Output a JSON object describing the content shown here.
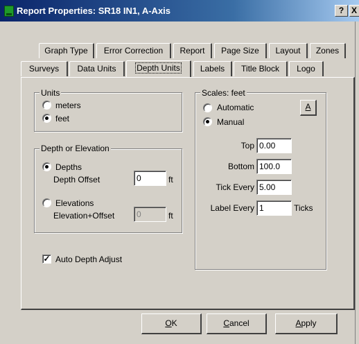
{
  "window": {
    "title": "Report Properties: SR18 IN1, A-Axis",
    "help_label": "?",
    "close_label": "X"
  },
  "tabs_row1": [
    {
      "label": "Graph Type"
    },
    {
      "label": "Error Correction"
    },
    {
      "label": "Report"
    },
    {
      "label": "Page Size"
    },
    {
      "label": "Layout"
    },
    {
      "label": "Zones"
    }
  ],
  "tabs_row2": [
    {
      "label": "Surveys"
    },
    {
      "label": "Data Units"
    },
    {
      "label": "Depth Units"
    },
    {
      "label": "Labels"
    },
    {
      "label": "Title Block"
    },
    {
      "label": "Logo"
    }
  ],
  "units": {
    "title": "Units",
    "meters": "meters",
    "feet": "feet",
    "selected": "feet"
  },
  "depth_or_elevation": {
    "title": "Depth or Elevation",
    "depths_label": "Depths",
    "depth_offset_label": "Depth Offset",
    "depth_offset_value": "0",
    "depth_offset_unit": "ft",
    "elevations_label": "Elevations",
    "elevation_offset_label": "Elevation+Offset",
    "elevation_offset_value": "0",
    "elevation_offset_unit": "ft",
    "selected": "Depths"
  },
  "auto_depth_adjust": {
    "label": "Auto Depth Adjust",
    "checked": true,
    "mark": "✓"
  },
  "scales": {
    "title": "Scales: feet",
    "automatic_label": "Automatic",
    "manual_label": "Manual",
    "selected": "Manual",
    "a_button_label": "A",
    "top_label": "Top",
    "top_value": "0.00",
    "bottom_label": "Bottom",
    "bottom_value": "100.0",
    "tick_every_label": "Tick Every",
    "tick_every_value": "5.00",
    "label_every_label": "Label Every",
    "label_every_value": "1",
    "ticks_label": "Ticks"
  },
  "buttons": {
    "ok_prefix": "",
    "ok_mnemonic": "O",
    "ok_rest": "K",
    "cancel_mnemonic": "C",
    "cancel_rest": "ancel",
    "apply_mnemonic": "A",
    "apply_rest": "pply"
  }
}
